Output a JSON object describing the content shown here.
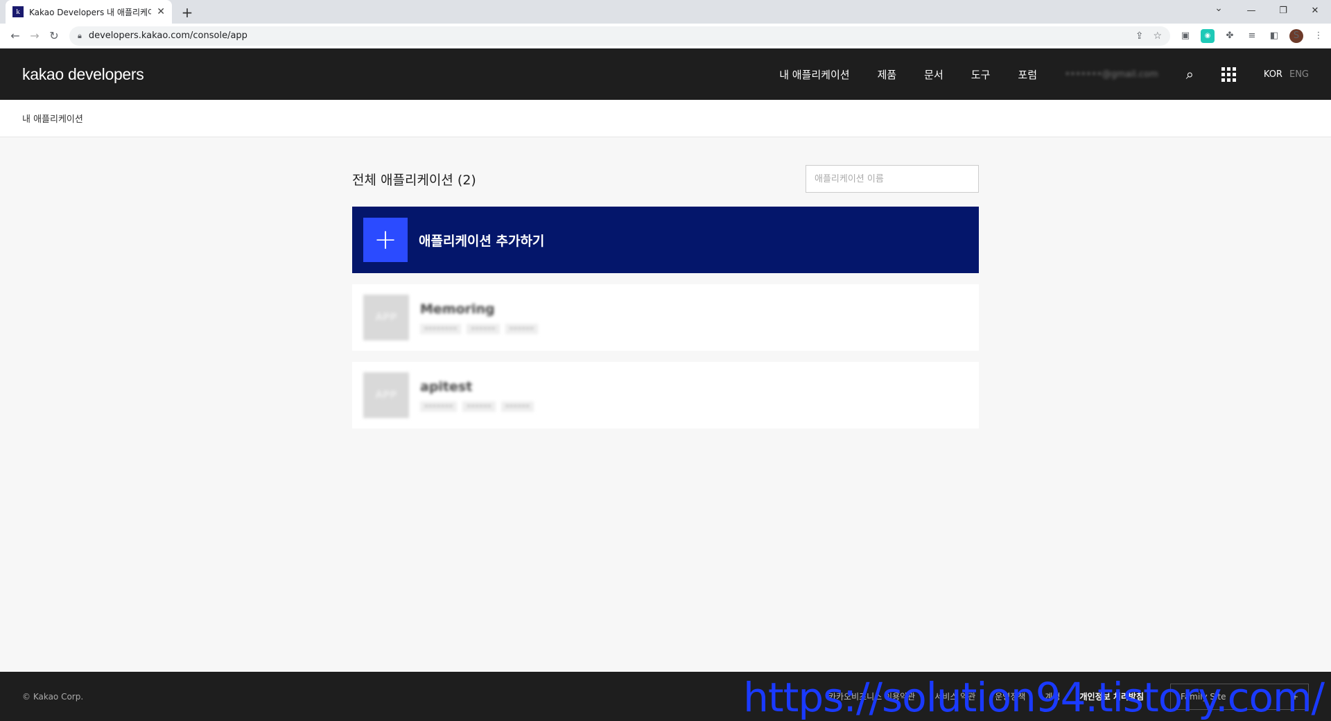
{
  "browser": {
    "tab_title": "Kakao Developers 내 애플리케이",
    "favicon_letter": "k",
    "url": "developers.kakao.com/console/app",
    "profile_initial": "S"
  },
  "header": {
    "logo_bold": "kakao",
    "logo_text": "developers",
    "nav": [
      "내 애플리케이션",
      "제품",
      "문서",
      "도구",
      "포럼"
    ],
    "email_blurred": "•••••••@gmail.com",
    "lang_kor": "KOR",
    "lang_eng": "ENG"
  },
  "breadcrumb": "내 애플리케이션",
  "main": {
    "title": "전체 애플리케이션 (2)",
    "search_placeholder": "애플리케이션 이름",
    "add_label": "애플리케이션 추가하기"
  },
  "apps": [
    {
      "name": "Memoring",
      "thumb": "APP",
      "tags": [
        "••••••••",
        "••••••",
        "••••••"
      ]
    },
    {
      "name": "apitest",
      "thumb": "APP",
      "tags": [
        "•••••••",
        "••••••",
        "••••••"
      ]
    }
  ],
  "footer": {
    "copyright": "© Kakao Corp.",
    "links": [
      "카카오비즈니스 이용약관",
      "서비스 약관",
      "운영정책",
      "계정",
      "개인정보 처리방침"
    ],
    "family_site": "Family Site"
  },
  "watermark": "https://solution94.tistory.com/"
}
